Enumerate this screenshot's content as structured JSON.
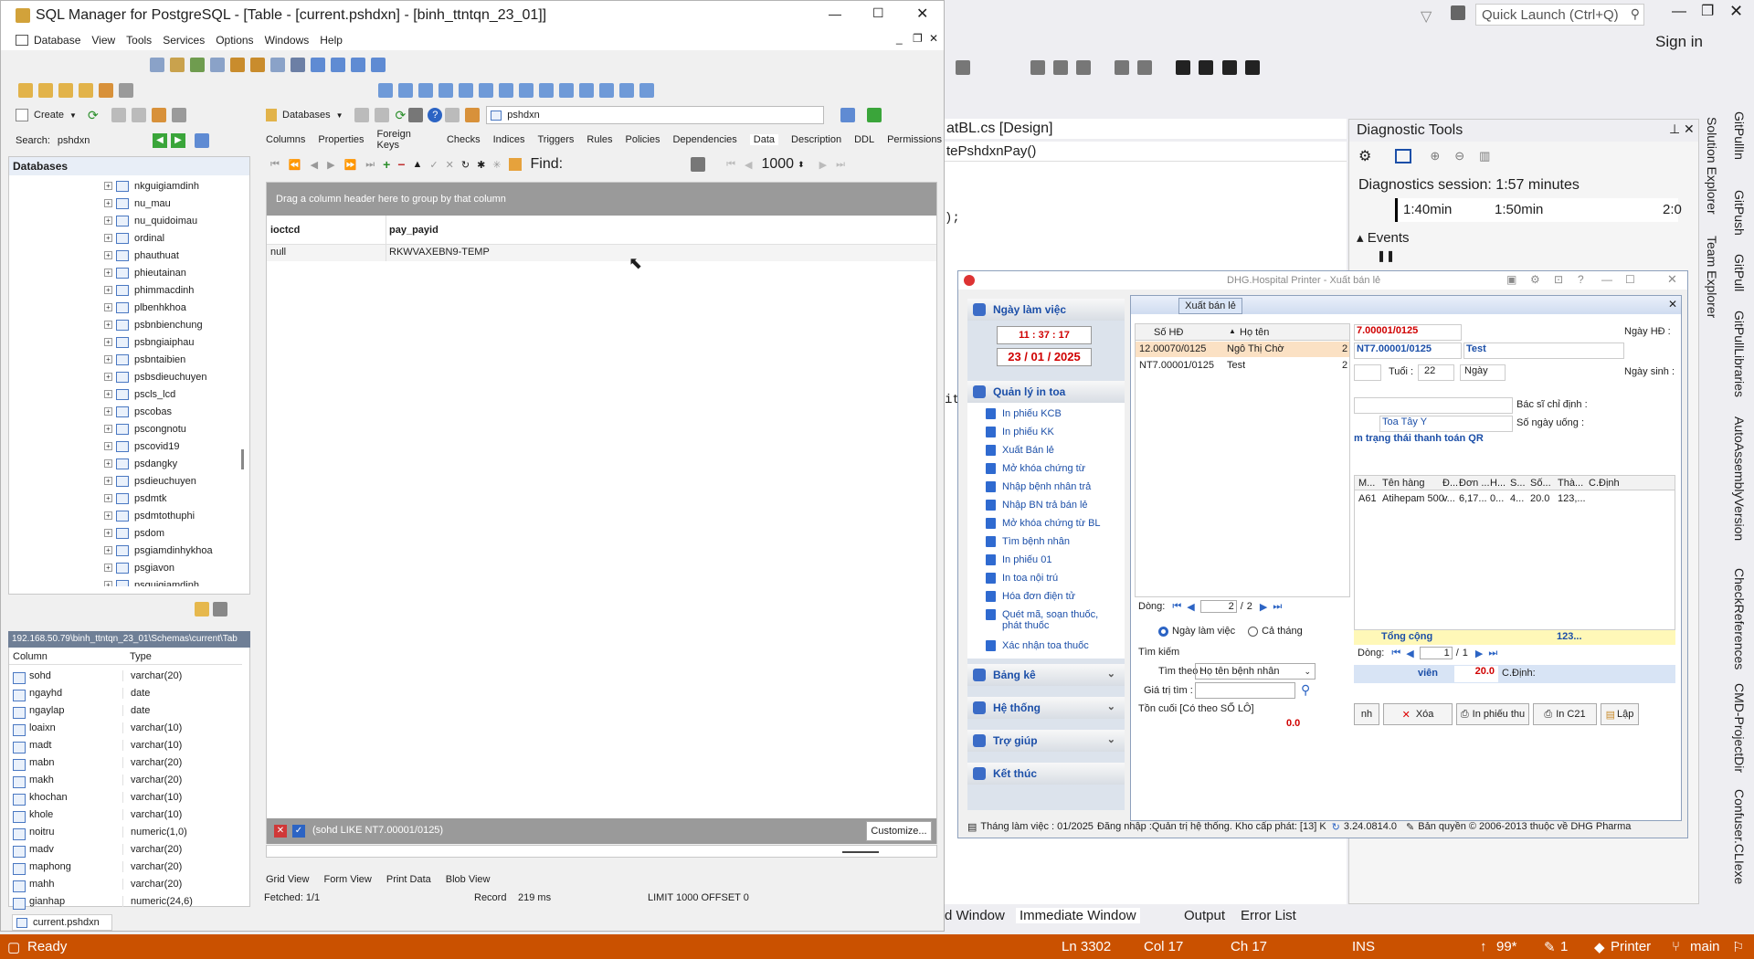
{
  "sql_manager": {
    "title": "SQL Manager for PostgreSQL - [Table - [current.pshdxn] - [binh_ttntqn_23_01]]",
    "menu": [
      "Database",
      "View",
      "Tools",
      "Services",
      "Options",
      "Windows",
      "Help"
    ],
    "create_label": "Create",
    "search_label": "Search:",
    "search_value": "pshdxn",
    "databases_dropdown": "Databases",
    "object_dropdown": "pshdxn",
    "tabs": [
      "Columns",
      "Properties",
      "Foreign Keys",
      "Checks",
      "Indices",
      "Triggers",
      "Rules",
      "Policies",
      "Dependencies",
      "Data",
      "Description",
      "DDL",
      "Permissions"
    ],
    "find_label": "Find:",
    "limit_value": "1000",
    "databases_header": "Databases",
    "tree_items": [
      "nkguigiamdinh",
      "nu_mau",
      "nu_quidoimau",
      "ordinal",
      "phauthuat",
      "phieutainan",
      "phimmacdinh",
      "plbenhkhoa",
      "psbnbienchung",
      "psbngiaiphau",
      "psbntaibien",
      "psbsdieuchuyen",
      "pscls_lcd",
      "pscobas",
      "pscongnotu",
      "pscovid19",
      "psdangky",
      "psdieuchuyen",
      "psdmtk",
      "psdmtothuphi",
      "psdom",
      "psgiamdinhykhoa",
      "psgiavon",
      "psguigiamdinh"
    ],
    "path": "192.168.50.79\\binh_ttntqn_23_01\\Schemas\\current\\Tab",
    "col_headers": [
      "Column",
      "Type"
    ],
    "columns": [
      [
        "sohd",
        "varchar(20)"
      ],
      [
        "ngayhd",
        "date"
      ],
      [
        "ngaylap",
        "date"
      ],
      [
        "loaixn",
        "varchar(10)"
      ],
      [
        "madt",
        "varchar(10)"
      ],
      [
        "mabn",
        "varchar(20)"
      ],
      [
        "makh",
        "varchar(20)"
      ],
      [
        "khochan",
        "varchar(10)"
      ],
      [
        "khole",
        "varchar(10)"
      ],
      [
        "noitru",
        "numeric(1,0)"
      ],
      [
        "madv",
        "varchar(20)"
      ],
      [
        "maphong",
        "varchar(20)"
      ],
      [
        "mahh",
        "varchar(20)"
      ],
      [
        "gianhap",
        "numeric(24,6)"
      ]
    ],
    "group_hint": "Drag a column header here to group by that column",
    "grid_headers": [
      "ioctcd",
      "pay_payid"
    ],
    "grid_row": [
      "null",
      "RKWVAXEBN9-TEMP"
    ],
    "filter_text": "(sohd LIKE NT7.00001/0125)",
    "customize_label": "Customize...",
    "view_tabs": [
      "Grid View",
      "Form View",
      "Print Data",
      "Blob View"
    ],
    "status": {
      "fetched": "Fetched: 1/1",
      "record": "Record",
      "time": "219 ms",
      "limit": "LIMIT 1000 OFFSET 0"
    },
    "doc_tab": "current.pshdxn"
  },
  "vs": {
    "quick_launch": "Quick Launch (Ctrl+Q)",
    "sign_in": "Sign in",
    "design_tab": "atBL.cs [Design]",
    "method": "tePshdxnPay()",
    "code_snippet": ");",
    "code_snippet2": "it",
    "diag_title": "Diagnostic Tools",
    "session": "Diagnostics session: 1:57 minutes",
    "timeline": [
      "1:40min",
      "1:50min",
      "2:0"
    ],
    "events_label": "Events",
    "right_tabs": [
      "Solution Explorer",
      "Team Explorer"
    ],
    "far_right_tabs": [
      "GitPullIn",
      "GitPush",
      "GitPull",
      "GitPullLibraries",
      "AutoAssemblyVersion",
      "CheckReferences",
      "CMD-ProjectDir",
      "Confuser.CLIexe"
    ],
    "bottom_tabs": [
      "d Window",
      "Immediate Window",
      "Output",
      "Error List"
    ],
    "status": {
      "ready": "Ready",
      "ln": "Ln 3302",
      "col": "Col 17",
      "ch": "Ch 17",
      "ins": "INS",
      "up": "99*",
      "pen": "1",
      "printer": "Printer",
      "branch": "main"
    }
  },
  "dhg": {
    "title": "DHG.Hospital Printer - Xuất bán lẻ",
    "tab": "Xuất bán lẻ",
    "work_day_header": "Ngày làm việc",
    "time": "11 : 37 : 17",
    "date": "23 / 01 / 2025",
    "manage_header": "Quản lý in toa",
    "nav_items": [
      "In phiếu KCB",
      "In phiếu KK",
      "Xuất Bán lẻ",
      "Mở khóa chứng từ",
      "Nhập bệnh nhân trả",
      "Nhập BN trả bán lẻ",
      "Mở khóa chứng từ BL",
      "Tìm bệnh nhân",
      "In phiếu 01",
      "In toa nội trú",
      "Hóa đơn điện tử",
      "Quét mã, soạn thuốc, phát thuốc",
      "Xác nhận toa thuốc"
    ],
    "groups": [
      "Bảng kê",
      "Hệ thống",
      "Trợ giúp",
      "Kết thúc"
    ],
    "list_headers": [
      "Số HĐ",
      "Họ tên"
    ],
    "list_rows": [
      [
        "12.00070/0125",
        "Ngô Thị Chờ",
        "2"
      ],
      [
        "NT7.00001/0125",
        "Test",
        "2"
      ]
    ],
    "dong_label": "Dòng:",
    "page_current": "2",
    "page_total": "2",
    "radio1": "Ngày làm việc",
    "radio2": "Cả tháng",
    "search_group": "Tìm kiếm",
    "search_by_label": "Tìm theo :",
    "search_by_value": "Họ tên bệnh nhân",
    "search_value_label": "Giá trị tìm :",
    "ton_cuoi": "Tồn cuối [Có theo SỐ LÔ]",
    "ton_value": "0.0",
    "invoice_no": "7.00001/0125",
    "ngay_hd_label": "Ngày HĐ :",
    "invoice_no2": "NT7.00001/0125",
    "patient_name": "Test",
    "age_label": "Tuổi :",
    "age_value": "22",
    "age_unit": "Ngày",
    "dob_label": "Ngày sinh :",
    "doctor_label": "Bác sĩ chỉ định :",
    "days_label": "Số ngày uống :",
    "toa_label": "Toa Tây Y",
    "qr_status": "m trạng thái thanh toán QR",
    "item_headers": [
      "M...",
      "Tên hàng",
      "Đ...",
      "Đơn ...",
      "H...",
      "S...",
      "Số...",
      "Thà...",
      "C.Định"
    ],
    "item_row": [
      "A61",
      "Atihepam 500",
      "v...",
      "6,17...",
      "0...",
      "4...",
      "20.0",
      "123,..."
    ],
    "total_label": "Tổng cộng",
    "total_value": "123...",
    "dong2_label": "Dòng:",
    "page2_current": "1",
    "page2_total": "1",
    "vien_label": "viên",
    "vien_value": "20.0",
    "cdinh_label": "C.Định:",
    "buttons": [
      "nh",
      "Xóa",
      "In phiếu thu",
      "In C21",
      "Lập"
    ],
    "status_month": "Tháng làm việc : 01/2025",
    "status_user": "Đăng nhập :Quản trị hệ thống. Kho cấp phát: [13] K",
    "version": "3.24.0814.0",
    "copyright": "Bản quyền © 2006-2013 thuộc về DHG Pharma"
  }
}
